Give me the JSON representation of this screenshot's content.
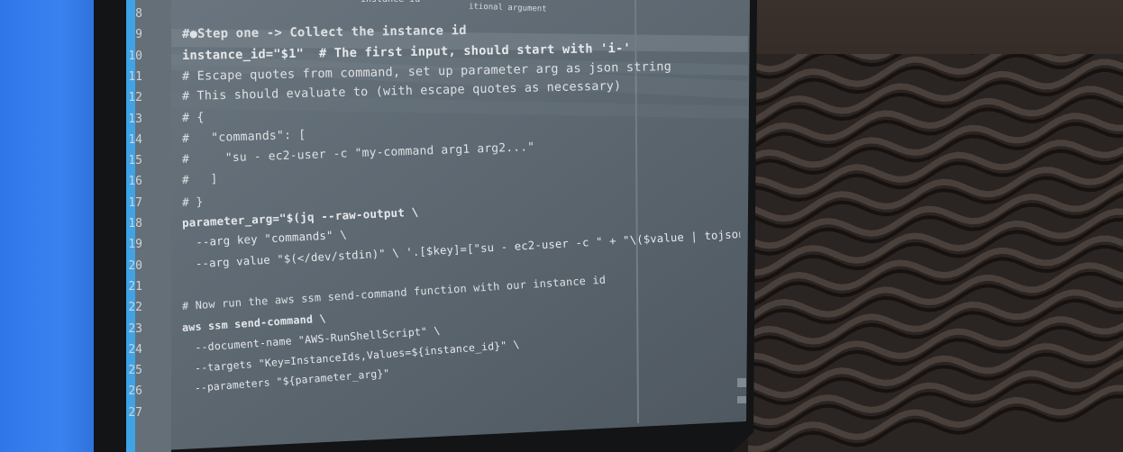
{
  "editor": {
    "header_fragments": [
      "instance-id",
      "itional argument"
    ],
    "lines": [
      {
        "num": "8",
        "text": ""
      },
      {
        "num": "9",
        "text": "#●Step one -> Collect the instance id"
      },
      {
        "num": "10",
        "text": "instance_id=\"$1\"  # The first input, should start with 'i-'"
      },
      {
        "num": "11",
        "text": "# Escape quotes from command, set up parameter arg as json string"
      },
      {
        "num": "12",
        "text": "# This should evaluate to (with escape quotes as necessary)"
      },
      {
        "num": "13",
        "text": "# {"
      },
      {
        "num": "14",
        "text": "#   \"commands\": ["
      },
      {
        "num": "15",
        "text": "#     \"su - ec2-user -c \"my-command arg1 arg2...\""
      },
      {
        "num": "16",
        "text": "#   ]"
      },
      {
        "num": "17",
        "text": "# }"
      },
      {
        "num": "18",
        "text": "parameter_arg=\"$(jq --raw-output \\"
      },
      {
        "num": "19",
        "text": "  --arg key \"commands\" \\"
      },
      {
        "num": "20",
        "text": "  --arg value \"$(</dev/stdin)\" \\ '.[$key]=[\"su - ec2-user -c \" + \"\\($value | tojson)\"]' <<< {})\""
      },
      {
        "num": "21",
        "text": ""
      },
      {
        "num": "22",
        "text": "# Now run the aws ssm send-command function with our instance id"
      },
      {
        "num": "23",
        "text": "aws ssm send-command \\"
      },
      {
        "num": "24",
        "text": "  --document-name \"AWS-RunShellScript\" \\"
      },
      {
        "num": "25",
        "text": "  --targets \"Key=InstanceIds,Values=${instance_id}\" \\"
      },
      {
        "num": "26",
        "text": "  --parameters \"${parameter_arg}\""
      },
      {
        "num": "27",
        "text": ""
      }
    ]
  },
  "colors": {
    "screen_bg": "#5f6a72",
    "accent_stripe": "#3fa3e6",
    "wall": "#3b82f0",
    "foam": "#2a2422"
  }
}
